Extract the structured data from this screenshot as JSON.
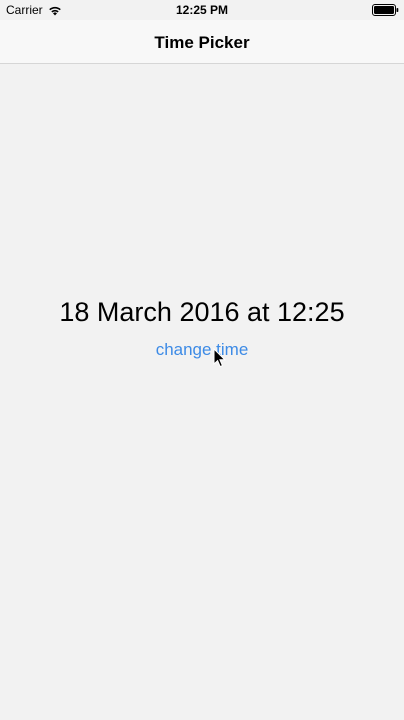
{
  "status_bar": {
    "carrier": "Carrier",
    "time": "12:25 PM",
    "wifi_icon": "wifi-icon",
    "battery_icon": "battery-icon"
  },
  "nav_bar": {
    "title": "Time Picker"
  },
  "main": {
    "date_label": "18 March 2016 at 12:25",
    "change_time_label": "change time"
  },
  "colors": {
    "background": "#f2f2f2",
    "navbar_background": "#f8f8f8",
    "link": "#3d8be6",
    "text": "#000000"
  },
  "cursor_icon": "mouse-pointer-icon"
}
